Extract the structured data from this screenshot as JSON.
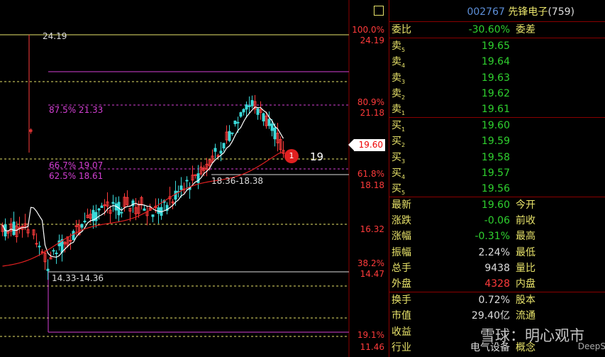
{
  "stock": {
    "code": "002767",
    "name": "先锋电子",
    "count": "(759)"
  },
  "overlay": {
    "peak_label": "24.19",
    "fib_875": "87.5% 21.33",
    "fib_667": "66.7% 19.07",
    "fib_625": "62.5% 18.61",
    "zone_upper": "18.36-18.38",
    "zone_lower": "14.33-14.36",
    "badge_num": "1",
    "badge_text": "19"
  },
  "axis": {
    "p100": "100.0%",
    "v100": "24.19",
    "p809": "80.9%",
    "v809": "21.18",
    "current": "19.60",
    "p618": "61.8%",
    "v618": "18.18",
    "v1632": "16.32",
    "p382": "38.2%",
    "v382": "14.47",
    "p191": "19.1%",
    "v191": "11.46"
  },
  "ratio": {
    "label": "委比",
    "value": "-30.60%",
    "label2": "委差"
  },
  "sell": [
    {
      "label": "卖",
      "n": "5",
      "price": "19.65"
    },
    {
      "label": "卖",
      "n": "4",
      "price": "19.64"
    },
    {
      "label": "卖",
      "n": "3",
      "price": "19.63"
    },
    {
      "label": "卖",
      "n": "2",
      "price": "19.62"
    },
    {
      "label": "卖",
      "n": "1",
      "price": "19.61"
    }
  ],
  "buy": [
    {
      "label": "买",
      "n": "1",
      "price": "19.60"
    },
    {
      "label": "买",
      "n": "2",
      "price": "19.59"
    },
    {
      "label": "买",
      "n": "3",
      "price": "19.58"
    },
    {
      "label": "买",
      "n": "4",
      "price": "19.57"
    },
    {
      "label": "买",
      "n": "5",
      "price": "19.56"
    }
  ],
  "quote": [
    {
      "label": "最新",
      "value": "19.60",
      "label2": "今开"
    },
    {
      "label": "涨跌",
      "value": "-0.06",
      "label2": "前收"
    },
    {
      "label": "涨幅",
      "value": "-0.31%",
      "label2": "最高"
    },
    {
      "label": "振幅",
      "value": "2.24%",
      "label2": "最低"
    },
    {
      "label": "总手",
      "value": "9438",
      "label2": "量比"
    },
    {
      "label": "外盘",
      "value": "4328",
      "label2": "内盘"
    }
  ],
  "info": [
    {
      "label": "换手",
      "value": "0.72%",
      "label2": "股本"
    },
    {
      "label": "市值",
      "value": "29.40亿",
      "label2": "流通"
    },
    {
      "label": "收益",
      "value": "",
      "label2": ""
    },
    {
      "label": "行业",
      "value": "电气设备",
      "label2": "概念"
    }
  ],
  "watermark": "雪球：明心观市",
  "watermark2": "DeepS"
}
